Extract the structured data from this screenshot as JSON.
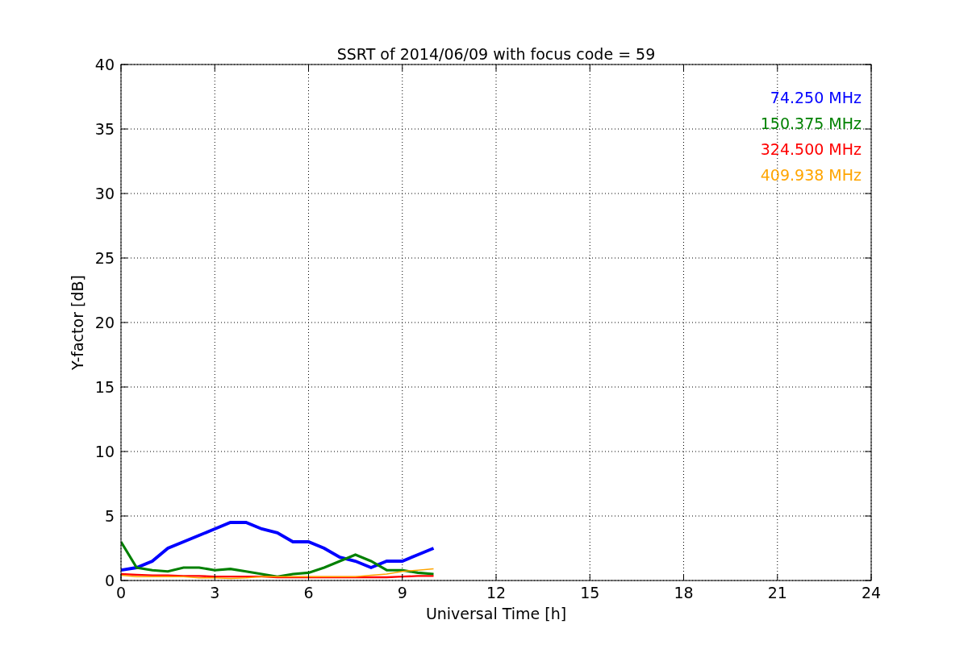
{
  "chart_data": {
    "type": "line",
    "title": "SSRT of 2014/06/09 with focus code = 59",
    "xlabel": "Universal Time [h]",
    "ylabel": "Y-factor [dB]",
    "x": [
      0,
      0.5,
      1,
      1.5,
      2,
      2.5,
      3,
      3.5,
      4,
      4.5,
      5,
      5.5,
      6,
      6.5,
      7,
      7.5,
      8,
      8.5,
      9,
      9.5,
      10
    ],
    "series": [
      {
        "name": "74.250 MHz",
        "color": "#0000ff",
        "values": [
          0.8,
          1,
          1.5,
          2.5,
          3,
          3.5,
          4,
          4.5,
          4.5,
          4,
          3.7,
          3,
          3,
          2.5,
          1.8,
          1.5,
          1,
          1.5,
          1.5,
          2,
          2.5
        ]
      },
      {
        "name": "150.375 MHz",
        "color": "#008000",
        "values": [
          3,
          1,
          0.8,
          0.7,
          1,
          1,
          0.8,
          0.9,
          0.7,
          0.5,
          0.3,
          0.5,
          0.6,
          1,
          1.5,
          2,
          1.5,
          0.8,
          0.8,
          0.6,
          0.5
        ]
      },
      {
        "name": "324.500 MHz",
        "color": "#ff0000",
        "values": [
          0.5,
          0.45,
          0.4,
          0.4,
          0.35,
          0.35,
          0.3,
          0.3,
          0.3,
          0.3,
          0.25,
          0.25,
          0.25,
          0.25,
          0.25,
          0.25,
          0.25,
          0.25,
          0.3,
          0.35,
          0.35
        ]
      },
      {
        "name": "409.938 MHz",
        "color": "#ffa500",
        "values": [
          0.4,
          0.3,
          0.3,
          0.3,
          0.3,
          0.2,
          0.2,
          0.15,
          0.2,
          0.3,
          0.3,
          0.3,
          0.3,
          0.3,
          0.3,
          0.3,
          0.4,
          0.5,
          0.7,
          0.8,
          0.9
        ]
      }
    ],
    "grid": true,
    "xlim": [
      0,
      24
    ],
    "ylim": [
      0,
      40
    ],
    "xticks": [
      0,
      3,
      6,
      9,
      12,
      15,
      18,
      21,
      24
    ],
    "yticks": [
      0,
      5,
      10,
      15,
      20,
      25,
      30,
      35,
      40
    ]
  }
}
